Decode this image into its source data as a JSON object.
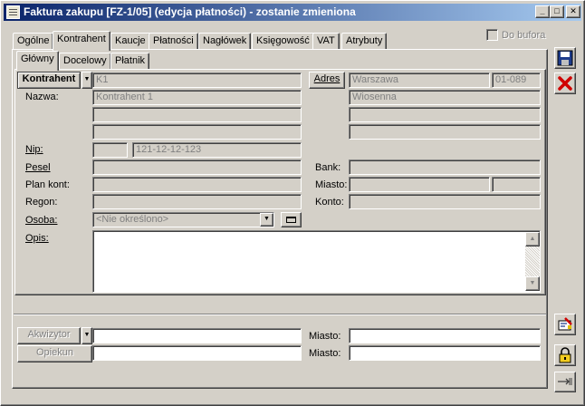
{
  "window": {
    "title": "Faktura zakupu [FZ-1/05] (edycja płatności) - zostanie zmieniona",
    "minimize": "_",
    "maximize": "□",
    "close": "✕"
  },
  "main_tabs": [
    "Ogólne",
    "Kontrahent",
    "Kaucje",
    "Płatności",
    "Nagłówek",
    "Księgowość",
    "VAT",
    "Atrybuty"
  ],
  "do_bufora": "Do bufora",
  "sub_tabs": [
    "Główny",
    "Docelowy",
    "Płatnik"
  ],
  "left": {
    "kontrahent_btn": "Kontrahent",
    "kontrahent_code": "K1",
    "nazwa_label": "Nazwa:",
    "nazwa_lines": [
      "Kontrahent 1",
      "",
      ""
    ],
    "nip_label": "Nip:",
    "nip_prefix": "",
    "nip_value": "121-12-12-123",
    "pesel_label": "Pesel",
    "pesel_value": "",
    "plan_kont_label": "Plan kont:",
    "plan_kont_value": "",
    "regon_label": "Regon:",
    "regon_value": "",
    "osoba_label": "Osoba:",
    "osoba_value": "<Nie określono>",
    "opis_label": "Opis:",
    "opis_value": ""
  },
  "right": {
    "adres_btn": "Adres",
    "miasto_value": "Warszawa",
    "kod_value": "01-089",
    "ulica_value": "Wiosenna",
    "extra_lines": [
      "",
      ""
    ],
    "bank_label": "Bank:",
    "bank_value": "",
    "miasto_label": "Miasto:",
    "bank_miasto_value": "",
    "bank_miasto_extra": "",
    "konto_label": "Konto:",
    "konto_value": ""
  },
  "bottom": {
    "akwizytor_btn": "Akwizytor",
    "akwizytor_value": "",
    "opiekun_btn": "Opiekun",
    "opiekun_value": "",
    "miasto1_label": "Miasto:",
    "miasto1_value": "",
    "miasto2_label": "Miasto:",
    "miasto2_value": ""
  },
  "icons": {
    "save": "floppy-disk-icon",
    "cancel": "red-x-icon",
    "lock": "padlock-icon"
  }
}
